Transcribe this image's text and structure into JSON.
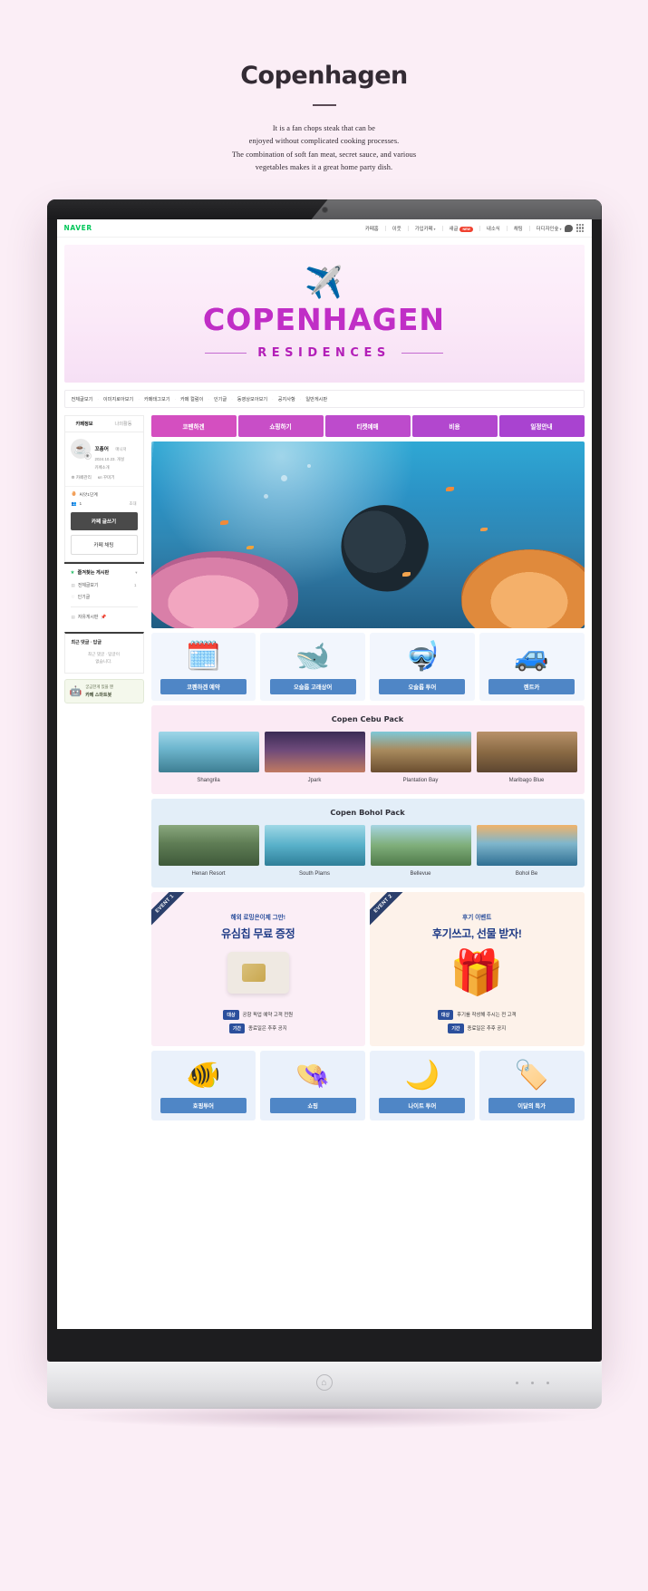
{
  "intro": {
    "title": "Copenhagen",
    "description": "It is a fan chops steak that can be\nenjoyed without complicated cooking processes.\nThe combination of soft fan meat, secret sauce, and various\nvegetables makes it a great home party dish."
  },
  "naver": {
    "logo": "NAVER",
    "menu": [
      {
        "label": "카페홈",
        "badge": "",
        "caret": false
      },
      {
        "label": "이웃",
        "badge": "",
        "caret": false
      },
      {
        "label": "가입카페",
        "badge": "",
        "caret": true
      },
      {
        "label": "새글",
        "badge": "NEW",
        "caret": false
      },
      {
        "label": "내소식",
        "badge": "",
        "caret": false
      },
      {
        "label": "채팅",
        "badge": "",
        "caret": false
      },
      {
        "label": "더디자인숲",
        "badge": "",
        "caret": true
      }
    ],
    "chat_icon": "chat-icon",
    "grid_icon": "grid-menu-icon"
  },
  "banner": {
    "plane_icon": "✈️",
    "title": "COPENHAGEN",
    "subtitle": "RESIDENCES",
    "title_color": "#c02ec6"
  },
  "cafe_nav": {
    "items": [
      "전체글보기",
      "이미지로아보기",
      "카페태그보기",
      "카페 컬럼이",
      "인기글",
      "동영상모아보기",
      "공지사항",
      "일반게시판"
    ]
  },
  "sidebar": {
    "tabs": [
      {
        "label": "카페정보",
        "active": true
      },
      {
        "label": "나의활동",
        "active": false
      }
    ],
    "profile": {
      "avatar_icon": "coffee-cup-avatar",
      "name": "꼬총어",
      "role": "매니저",
      "meta_line1": "2024.10.23. 개설",
      "meta_line2": "카페소개"
    },
    "links": [
      "⚙ 카페관리",
      "кл 꾸미기"
    ],
    "level": {
      "icon": "🥚",
      "label": "씨앗1단계"
    },
    "members": {
      "icon": "👥",
      "count": "1",
      "right": "초대"
    },
    "write_button": "카페 글쓰기",
    "chat_button": "카페 채팅",
    "favorites": {
      "title": "즐겨찾는 게시판",
      "star_icon": "star-icon",
      "caret_icon": "chevron-down-icon",
      "rows": [
        {
          "icon": "▤",
          "label": "전체글보기",
          "count": "1"
        },
        {
          "icon": "♡",
          "label": "인기글",
          "count": ""
        }
      ],
      "free_board": {
        "label": "자유게시판",
        "pin": "📌"
      }
    },
    "recent": {
      "title": "최근 댓글 · 답글",
      "body": "최근 댓글 · 답글이\n없습니다."
    },
    "bot": {
      "icon": "🤖",
      "line1": "궁금한게 있을 땐",
      "line2": "카페 스마트봇"
    }
  },
  "main": {
    "tabs": [
      {
        "label": "코펜하겐",
        "color": "#d44fc0"
      },
      {
        "label": "쇼핑하기",
        "color": "#c84ec7"
      },
      {
        "label": "티켓예매",
        "color": "#bd4bcc"
      },
      {
        "label": "비용",
        "color": "#b247ce"
      },
      {
        "label": "일정안내",
        "color": "#a943d0"
      }
    ],
    "hero": {
      "alt": "scuba-diver-coral-reef-photo"
    },
    "icon_cards": [
      {
        "emoji": "🗓️",
        "label": "코펜하겐 예약"
      },
      {
        "emoji": "🐋",
        "label": "오슬롭 고래상어"
      },
      {
        "emoji": "🤿",
        "label": "오슬롭 투어"
      },
      {
        "emoji": "🚙",
        "label": "렌트카"
      }
    ],
    "packs": [
      {
        "id": "cebu",
        "title": "Copen Cebu Pack",
        "items": [
          {
            "caption": "Shangrila",
            "alt": "resort-pool-photo"
          },
          {
            "caption": "Jpark",
            "alt": "resort-night-photo"
          },
          {
            "caption": "Plantation Bay",
            "alt": "boardwalk-photo"
          },
          {
            "caption": "Maribago Blue",
            "alt": "beach-loungers-photo"
          }
        ]
      },
      {
        "id": "bohol",
        "title": "Copen Bohol Pack",
        "items": [
          {
            "caption": "Henan Resort",
            "alt": "villa-photo"
          },
          {
            "caption": "South Plams",
            "alt": "palm-pool-photo"
          },
          {
            "caption": "Bellevue",
            "alt": "beach-huts-photo"
          },
          {
            "caption": "Bohol Be",
            "alt": "infinity-pool-sunset-photo"
          }
        ]
      }
    ],
    "events": [
      {
        "ribbon": "EVENT 1",
        "kicker": "해외 로밍은이제 그만!",
        "title": "유심칩 무료 증정",
        "art": "sim-card",
        "rows": [
          {
            "tag": "대상",
            "text": "공항 픽업 예약 고객 전원"
          },
          {
            "tag": "기간",
            "text": "종료일은 추후 공지"
          }
        ]
      },
      {
        "ribbon": "EVENT 2",
        "kicker": "후기 이벤트",
        "title": "후기쓰고, 선물 받자!",
        "art": "🎁",
        "rows": [
          {
            "tag": "대상",
            "text": "후기를 작성해 주시는 전 고객"
          },
          {
            "tag": "기간",
            "text": "종료일은 추후 공지"
          }
        ]
      }
    ],
    "bottom_cards": [
      {
        "emoji": "🐠",
        "label": "호핑투어"
      },
      {
        "emoji": "👒",
        "label": "쇼핑"
      },
      {
        "emoji": "🌙",
        "label": "나이트 투어"
      },
      {
        "emoji": "🏷️",
        "label": "이달의 특가"
      }
    ]
  },
  "device": {
    "home_icon": "home-button-icon"
  }
}
